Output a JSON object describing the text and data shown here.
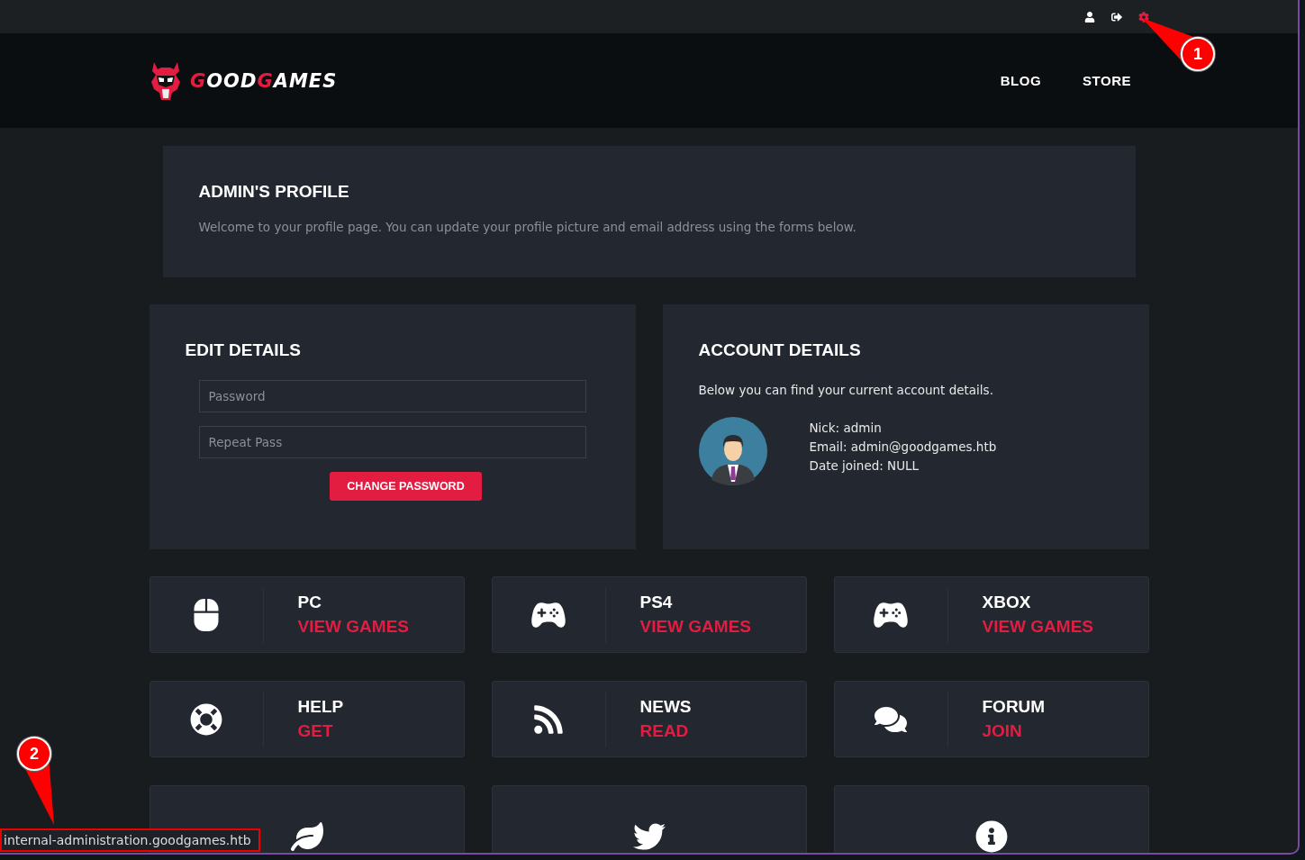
{
  "top_actions": [
    {
      "kind": "user",
      "selected": false
    },
    {
      "kind": "logout",
      "selected": false
    },
    {
      "kind": "settings",
      "selected": true
    }
  ],
  "header": {
    "logo": {
      "first": "G",
      "part1": "OOD",
      "second": "G",
      "part2": "AMES"
    },
    "nav": [
      "BLOG",
      "STORE"
    ]
  },
  "profile": {
    "title": "ADMIN'S PROFILE",
    "text": "Welcome to your profile page. You can update your profile picture and email address using the forms below."
  },
  "edit_details": {
    "title": "EDIT DETAILS",
    "fields": [
      {
        "placeholder": "Password"
      },
      {
        "placeholder": "Repeat Pass"
      }
    ],
    "button": "CHANGE PASSWORD"
  },
  "account_details": {
    "title": "ACCOUNT DETAILS",
    "intro": "Below you can find your current account details.",
    "lines": [
      "Nick: admin",
      "Email: admin@goodgames.htb",
      "Date joined: NULL"
    ]
  },
  "tiles": [
    {
      "kind": "mouse",
      "title": "PC",
      "action": "VIEW GAMES"
    },
    {
      "kind": "gamepad",
      "title": "PS4",
      "action": "VIEW GAMES"
    },
    {
      "kind": "controller",
      "title": "XBOX",
      "action": "VIEW GAMES"
    },
    {
      "kind": "lifebuoy",
      "title": "HELP",
      "action": "GET"
    },
    {
      "kind": "rss",
      "title": "NEWS",
      "action": "READ"
    },
    {
      "kind": "chat",
      "title": "FORUM",
      "action": "JOIN"
    },
    {
      "kind": "leaf"
    },
    {
      "kind": "twitter"
    },
    {
      "kind": "info"
    }
  ],
  "status_bar": {
    "url": "internal-administration.goodgames.htb"
  },
  "annotations": [
    {
      "label": "1"
    },
    {
      "label": "2"
    }
  ]
}
